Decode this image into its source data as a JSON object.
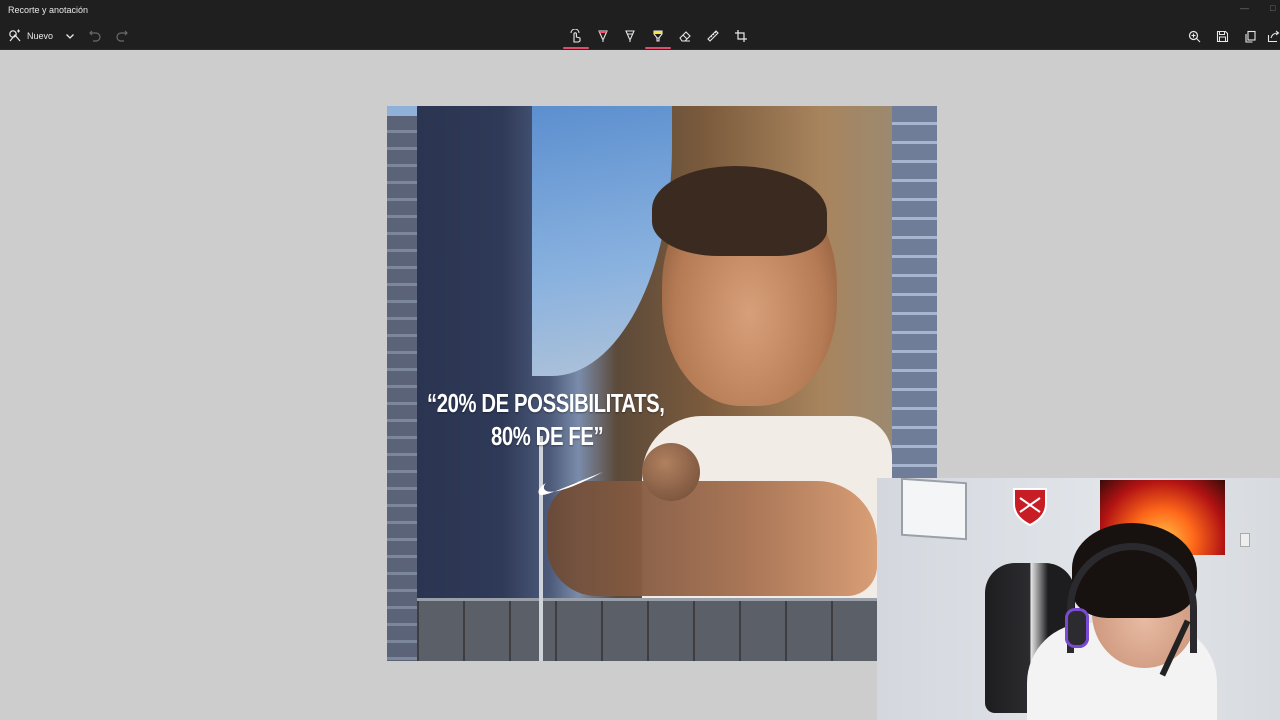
{
  "window": {
    "title": "Recorte y anotación"
  },
  "toolbar": {
    "new_label": "Nuevo"
  },
  "capture": {
    "quote_line1": "“20% DE POSSIBILITATS,",
    "quote_line2": "80% DE FE”"
  },
  "colors": {
    "titlebar_bg": "#1f1f1f",
    "canvas_bg": "#cdcdcd",
    "active_tool_underline": "#e34b6b",
    "highlighter": "#f5e542",
    "pen_red": "#ff4d6d"
  },
  "icons": [
    "new-snip-icon",
    "chevron-down-icon",
    "undo-icon",
    "redo-icon",
    "touch-writing-icon",
    "ballpoint-pen-icon",
    "pencil-pen-icon",
    "highlighter-icon",
    "eraser-icon",
    "ruler-icon",
    "crop-icon",
    "zoom-icon",
    "save-icon",
    "copy-icon",
    "share-icon"
  ]
}
